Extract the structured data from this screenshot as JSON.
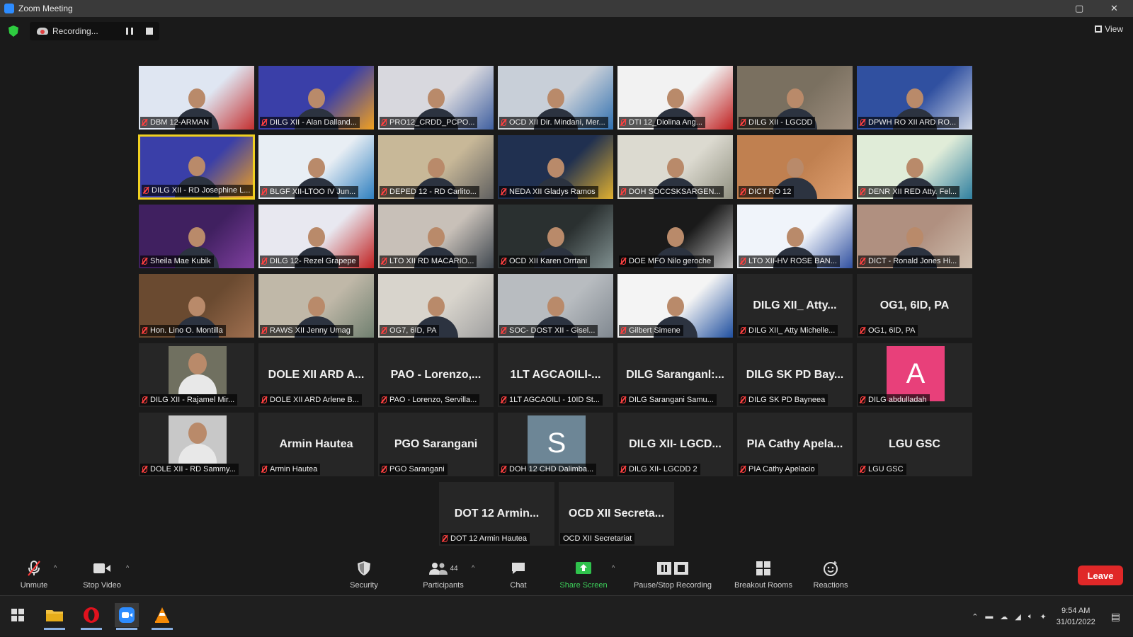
{
  "window": {
    "title": "Zoom Meeting"
  },
  "recording": {
    "label": "Recording..."
  },
  "view": {
    "label": "View"
  },
  "tiles": [
    {
      "row": 0,
      "col": 0,
      "kind": "video",
      "label": "DBM 12-ARMAN",
      "bg": "#dfe6f2",
      "accent": "#c43030"
    },
    {
      "row": 0,
      "col": 1,
      "kind": "video",
      "label": "DILG XII - Alan Dalland...",
      "bg": "#3a3fa8",
      "accent": "#f0a020"
    },
    {
      "row": 0,
      "col": 2,
      "kind": "video",
      "label": "PRO12_CRDD_PCPO...",
      "bg": "#d8d8de",
      "accent": "#4060a0"
    },
    {
      "row": 0,
      "col": 3,
      "kind": "video",
      "label": "OCD XII Dir. Mindani, Mer...",
      "bg": "#c8cfd8",
      "accent": "#3070b0"
    },
    {
      "row": 0,
      "col": 4,
      "kind": "video",
      "label": "DTI 12_Diolina Ang...",
      "bg": "#f2f2f2",
      "accent": "#c02020"
    },
    {
      "row": 0,
      "col": 5,
      "kind": "video",
      "label": "DILG XII - LGCDD",
      "bg": "#7a7060",
      "accent": "#a09080"
    },
    {
      "row": 0,
      "col": 6,
      "kind": "video",
      "label": "DPWH RO XII ARD RO...",
      "bg": "#3050a0",
      "accent": "#d0d8e8"
    },
    {
      "row": 1,
      "col": 0,
      "kind": "video",
      "label": "DILG XII - RD Josephine L...",
      "bg": "#3a3fa8",
      "accent": "#f0a020",
      "active": true
    },
    {
      "row": 1,
      "col": 1,
      "kind": "video",
      "label": "BLGF XII-LTOO IV Jun...",
      "bg": "#e8eef4",
      "accent": "#3080c0"
    },
    {
      "row": 1,
      "col": 2,
      "kind": "video",
      "label": "DEPED 12 - RD Carlito...",
      "bg": "#c8b898",
      "accent": "#606060"
    },
    {
      "row": 1,
      "col": 3,
      "kind": "video",
      "label": "NEDA XII Gladys Ramos",
      "bg": "#203050",
      "accent": "#e0b030"
    },
    {
      "row": 1,
      "col": 4,
      "kind": "video",
      "label": "DOH SOCCSKSARGEN...",
      "bg": "#dcdad0",
      "accent": "#909080"
    },
    {
      "row": 1,
      "col": 5,
      "kind": "video",
      "label": "DICT RO 12",
      "bg": "#c08050",
      "accent": "#e0a070"
    },
    {
      "row": 1,
      "col": 6,
      "kind": "video",
      "label": "DENR XII RED Atty. Fel...",
      "bg": "#e0ecd8",
      "accent": "#3080a0"
    },
    {
      "row": 2,
      "col": 0,
      "kind": "video",
      "label": "Sheila Mae Kubik",
      "bg": "#402060",
      "accent": "#8040a0"
    },
    {
      "row": 2,
      "col": 1,
      "kind": "video",
      "label": "DILG 12- Rezel Grapepe",
      "bg": "#e8e8f0",
      "accent": "#c02020"
    },
    {
      "row": 2,
      "col": 2,
      "kind": "video",
      "label": "LTO XII RD MACARIO...",
      "bg": "#c8c0b8",
      "accent": "#404850"
    },
    {
      "row": 2,
      "col": 3,
      "kind": "video",
      "label": "OCD XII Karen Orrtani",
      "bg": "#2a3030",
      "accent": "#809090"
    },
    {
      "row": 2,
      "col": 4,
      "kind": "video",
      "label": "DOE MFO Nilo geroche",
      "bg": "#1a1a1a",
      "accent": "#c0c0c0"
    },
    {
      "row": 2,
      "col": 5,
      "kind": "video",
      "label": "LTO XII-HV ROSE BAN...",
      "bg": "#f0f4fa",
      "accent": "#3050a0"
    },
    {
      "row": 2,
      "col": 6,
      "kind": "video",
      "label": "DICT - Ronald Jones Hi...",
      "bg": "#b09080",
      "accent": "#d0c0b0"
    },
    {
      "row": 3,
      "col": 0,
      "kind": "video",
      "label": "Hon. Lino O. Montilla",
      "bg": "#6a4a30",
      "accent": "#a07050"
    },
    {
      "row": 3,
      "col": 1,
      "kind": "video",
      "label": "RAWS XII Jenny Umag",
      "bg": "#c0b8a8",
      "accent": "#708070"
    },
    {
      "row": 3,
      "col": 2,
      "kind": "video",
      "label": "OG7, 6ID, PA",
      "bg": "#d8d4cc",
      "accent": "#a0a0a0"
    },
    {
      "row": 3,
      "col": 3,
      "kind": "video",
      "label": "SOC- DOST XII - Gisel...",
      "bg": "#b8bcc0",
      "accent": "#808890"
    },
    {
      "row": 3,
      "col": 4,
      "kind": "video",
      "label": "Gilbert Simene",
      "bg": "#f4f4f4",
      "accent": "#2050a0"
    },
    {
      "row": 3,
      "col": 5,
      "kind": "name",
      "name": "DILG XII_ Atty...",
      "label": "DILG XII_ Atty Michelle..."
    },
    {
      "row": 3,
      "col": 6,
      "kind": "name",
      "name": "OG1, 6ID, PA",
      "label": "OG1, 6ID, PA"
    },
    {
      "row": 4,
      "col": 0,
      "kind": "photo",
      "label": "DILG XII - Rajamel Mir...",
      "bg": "#707060"
    },
    {
      "row": 4,
      "col": 1,
      "kind": "name",
      "name": "DOLE XII ARD A...",
      "label": "DOLE XII ARD Arlene B..."
    },
    {
      "row": 4,
      "col": 2,
      "kind": "name",
      "name": "PAO - Lorenzo,...",
      "label": "PAO - Lorenzo, Servilla..."
    },
    {
      "row": 4,
      "col": 3,
      "kind": "name",
      "name": "1LT AGCAOILI-...",
      "label": "1LT AGCAOILI - 10ID St..."
    },
    {
      "row": 4,
      "col": 4,
      "kind": "name",
      "name": "DILG Saranganl:...",
      "label": "DILG Sarangani Samu..."
    },
    {
      "row": 4,
      "col": 5,
      "kind": "name",
      "name": "DILG SK PD Bay...",
      "label": "DILG SK PD Bayneea"
    },
    {
      "row": 4,
      "col": 6,
      "kind": "avatar",
      "letter": "A",
      "color": "#e8407a",
      "label": "DILG abdulladah"
    },
    {
      "row": 5,
      "col": 0,
      "kind": "photo",
      "label": "DOLE XII - RD Sammy...",
      "bg": "#c8c8c8"
    },
    {
      "row": 5,
      "col": 1,
      "kind": "name",
      "name": "Armin Hautea",
      "label": "Armin Hautea"
    },
    {
      "row": 5,
      "col": 2,
      "kind": "name",
      "name": "PGO Sarangani",
      "label": "PGO Sarangani"
    },
    {
      "row": 5,
      "col": 3,
      "kind": "avatar",
      "letter": "S",
      "color": "#6d8696",
      "label": "DOH 12 CHD Dalimba..."
    },
    {
      "row": 5,
      "col": 4,
      "kind": "name",
      "name": "DILG XII- LGCD...",
      "label": "DILG XII- LGCDD 2"
    },
    {
      "row": 5,
      "col": 5,
      "kind": "name",
      "name": "PIA Cathy Apela...",
      "label": "PIA Cathy Apelacio"
    },
    {
      "row": 5,
      "col": 6,
      "kind": "name",
      "name": "LGU GSC",
      "label": "LGU GSC"
    },
    {
      "row": 6,
      "col": 0,
      "kind": "name",
      "name": "DOT 12 Armin...",
      "label": "DOT 12 Armin Hautea"
    },
    {
      "row": 6,
      "col": 1,
      "kind": "name",
      "name": "OCD XII Secreta...",
      "label": "OCD XII Secretariat",
      "nomic": true
    }
  ],
  "toolbar": {
    "unmute": "Unmute",
    "stop_video": "Stop Video",
    "security": "Security",
    "participants": "Participants",
    "participants_count": "44",
    "chat": "Chat",
    "share_screen": "Share Screen",
    "pause_stop_recording": "Pause/Stop Recording",
    "breakout_rooms": "Breakout Rooms",
    "reactions": "Reactions",
    "leave": "Leave"
  },
  "taskbar": {
    "time": "9:54 AM",
    "date": "31/01/2022"
  }
}
